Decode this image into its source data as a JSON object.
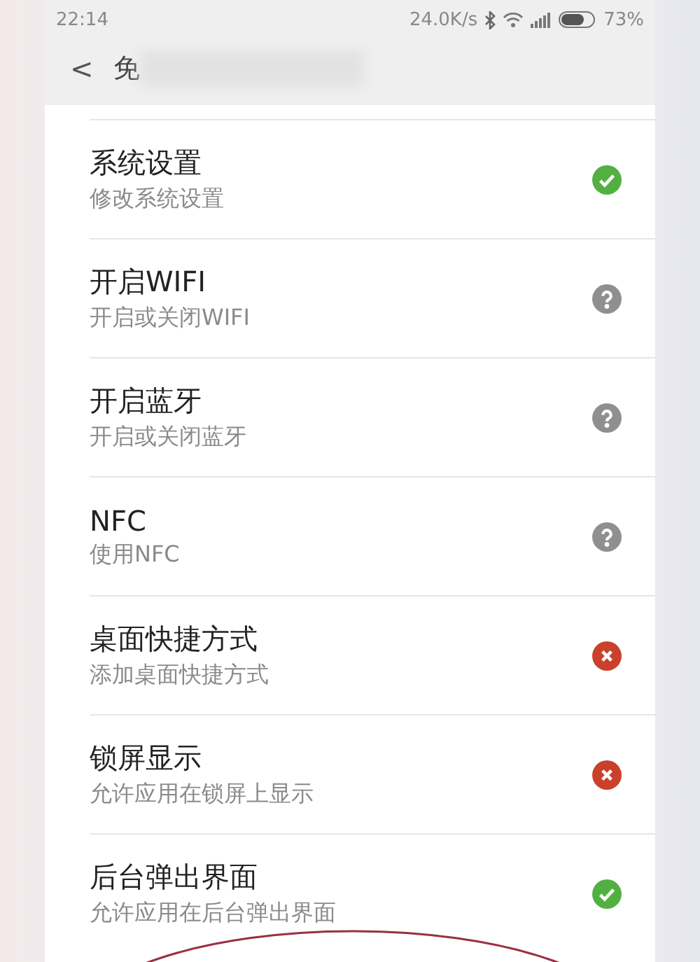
{
  "status_bar": {
    "time": "22:14",
    "speed": "24.0K/s",
    "battery_text": "73%"
  },
  "header": {
    "back": "<",
    "title": "免"
  },
  "permissions": [
    {
      "title": "系统设置",
      "subtitle": "修改系统设置",
      "kind": "allowed"
    },
    {
      "title": "开启WIFI",
      "subtitle": "开启或关闭WIFI",
      "kind": "ask"
    },
    {
      "title": "开启蓝牙",
      "subtitle": "开启或关闭蓝牙",
      "kind": "ask"
    },
    {
      "title": "NFC",
      "subtitle": "使用NFC",
      "kind": "ask"
    },
    {
      "title": "桌面快捷方式",
      "subtitle": "添加桌面快捷方式",
      "kind": "denied"
    },
    {
      "title": "锁屏显示",
      "subtitle": "允许应用在锁屏上显示",
      "kind": "denied"
    },
    {
      "title": "后台弹出界面",
      "subtitle": "允许应用在后台弹出界面",
      "kind": "allowed"
    }
  ]
}
